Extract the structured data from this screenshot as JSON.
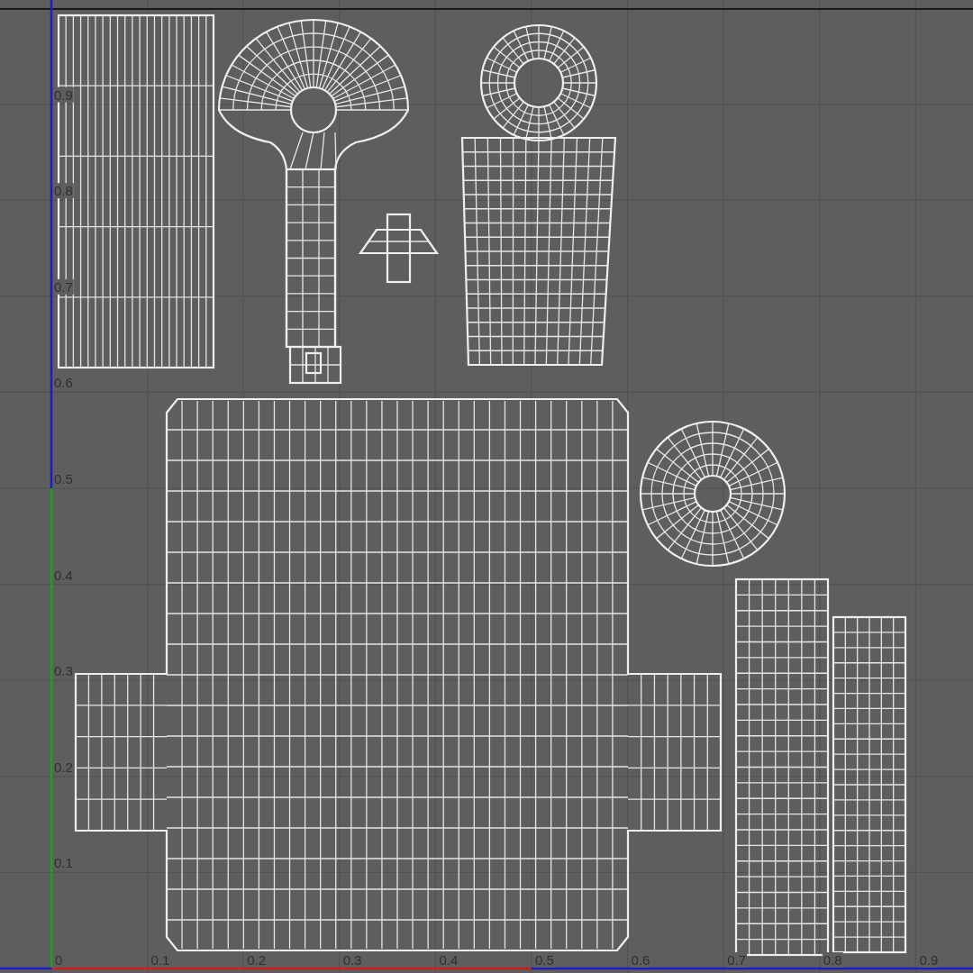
{
  "uv_editor": {
    "v_axis_labels": [
      "0.9",
      "0.8",
      "0.7",
      "0.6",
      "0.5",
      "0.4",
      "0.3",
      "0.2",
      "0.1"
    ],
    "u_axis_labels": [
      "0",
      "0.1",
      "0.2",
      "0.3",
      "0.4",
      "0.5",
      "0.6",
      "0.7",
      "0.8",
      "0.9"
    ]
  }
}
